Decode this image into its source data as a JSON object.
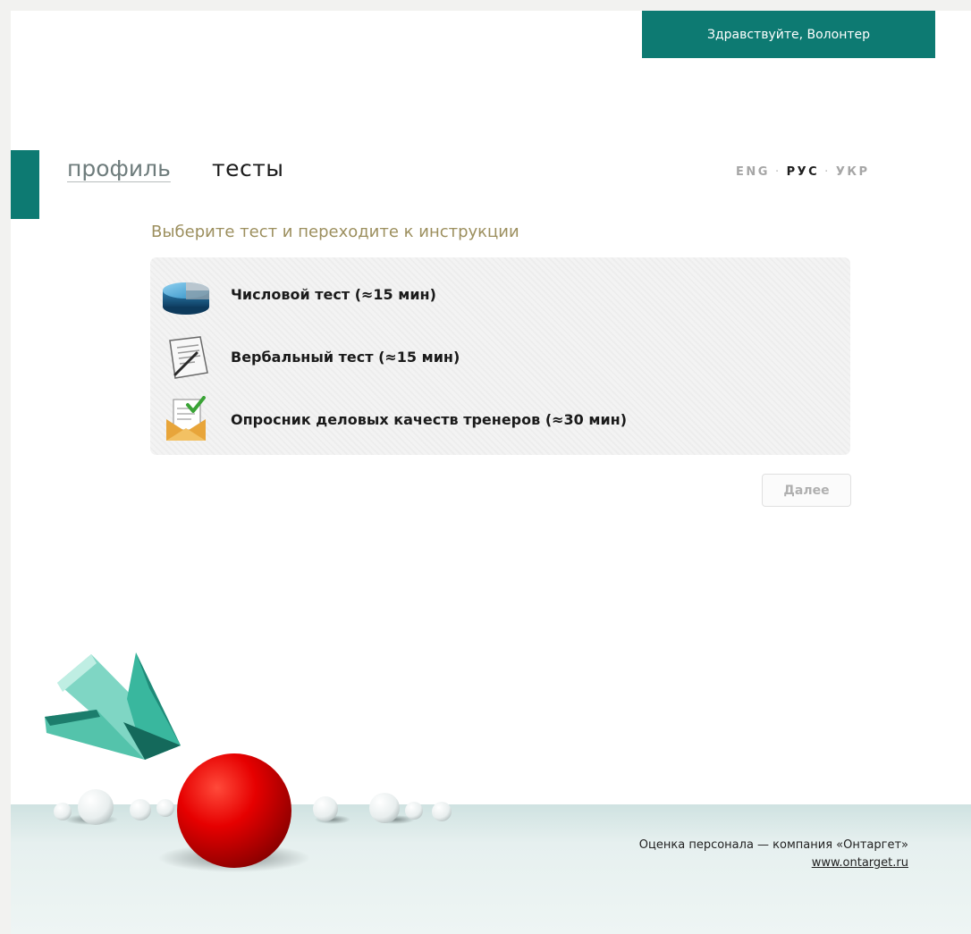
{
  "header": {
    "greeting": "Здравствуйте, Волонтер"
  },
  "nav": {
    "profile": "профиль",
    "tests": "тесты"
  },
  "languages": [
    {
      "label": "ENG",
      "active": false
    },
    {
      "label": "РУС",
      "active": true
    },
    {
      "label": "УКР",
      "active": false
    }
  ],
  "language_separator": "·",
  "main": {
    "subtitle": "Выберите тест и переходите к инструкции",
    "tests": [
      {
        "label": "Числовой тест (≈15 мин)",
        "icon": "numeric-test-icon"
      },
      {
        "label": "Вербальный тест (≈15 мин)",
        "icon": "verbal-test-icon"
      },
      {
        "label": "Опросник деловых качеств тренеров (≈30 мин)",
        "icon": "questionnaire-icon"
      }
    ],
    "next_button": "Далее"
  },
  "footer": {
    "company": "Оценка персонала — компания «Онтаргет»",
    "website": "www.ontarget.ru"
  },
  "colors": {
    "accent": "#0d7a72",
    "subtitle": "#9c8f5e",
    "ball": "#e60000"
  }
}
